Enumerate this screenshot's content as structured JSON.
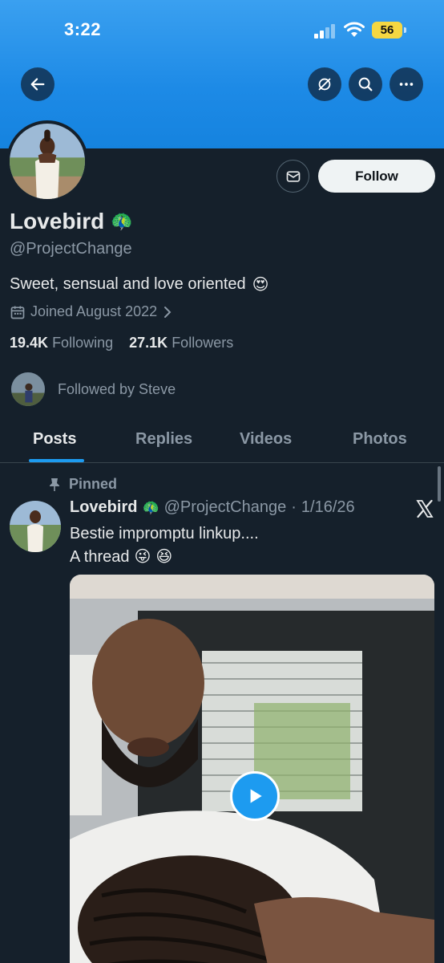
{
  "status_bar": {
    "time": "3:22",
    "battery": "56"
  },
  "header_actions": [
    "back-arrow-icon",
    "circle-slash-icon",
    "search-icon",
    "more-dots-icon"
  ],
  "profile": {
    "name": "Lovebird",
    "handle": "@ProjectChange",
    "bio": "Sweet, sensual and love oriented",
    "joined": "Joined August 2022",
    "following_count": "19.4K",
    "following_label": "Following",
    "followers_count": "27.1K",
    "followers_label": "Followers",
    "followed_by": "Followed by Steve",
    "follow_label": "Follow"
  },
  "tabs": [
    {
      "label": "Posts",
      "active": true
    },
    {
      "label": "Replies"
    },
    {
      "label": "Videos"
    },
    {
      "label": "Photos"
    }
  ],
  "post": {
    "pinned_label": "Pinned",
    "author_name": "Lovebird",
    "author_handle": "@ProjectChange",
    "separator": "·",
    "date": "1/16/26",
    "text_line1": "Bestie impromptu linkup....",
    "text_line2": "A thread"
  },
  "colors": {
    "accent": "#1d9bf0",
    "background": "#15202b",
    "secondary_text": "#8b98a5"
  }
}
